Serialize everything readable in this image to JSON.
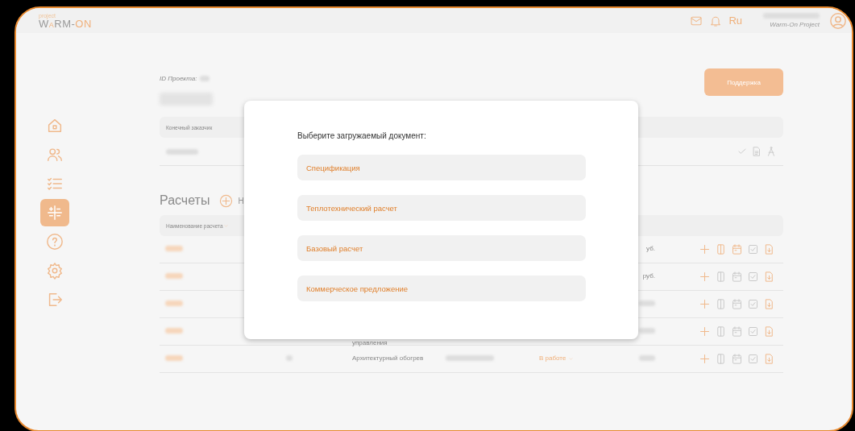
{
  "header": {
    "logo_small": "project",
    "logo_parts": [
      {
        "text": "W",
        "accent": false
      },
      {
        "text": "A",
        "accent": true
      },
      {
        "text": "RM-",
        "accent": false
      },
      {
        "text": "ON",
        "accent": true
      }
    ],
    "language": "Ru",
    "user_company": "Warm-On Project"
  },
  "sidebar": {
    "items": [
      {
        "selected": false
      },
      {
        "selected": false
      },
      {
        "selected": false
      },
      {
        "selected": true
      },
      {
        "selected": false
      },
      {
        "selected": false
      },
      {
        "selected": false
      }
    ]
  },
  "project": {
    "id_label": "ID Проекта:",
    "support_button": "Поддержка",
    "customer_header": "Конечный заказчик"
  },
  "calculations": {
    "title": "Расчеты",
    "add_label": "Н",
    "name_header": "Наименование расчета",
    "rows": [
      {
        "kind": "plain",
        "price": "уб.",
        "sheet_on": true,
        "calendar_on": true
      },
      {
        "kind": "plain",
        "price": "руб.",
        "sheet_on": false,
        "calendar_on": false
      },
      {
        "kind": "plain",
        "sheet_on": false,
        "calendar_on": false
      },
      {
        "kind": "wrapped",
        "type": "управления",
        "sheet_on": false,
        "calendar_on": false
      },
      {
        "kind": "plain",
        "type": "Архитектурный обогрев",
        "status": "В работе",
        "sheet_on": false,
        "calendar_on": false
      }
    ]
  },
  "dialog": {
    "title": "Выберите загружаемый документ:",
    "options": [
      "Спецификация",
      "Теплотехнический расчет",
      "Базовый расчет",
      "Коммерческое предложение"
    ]
  }
}
